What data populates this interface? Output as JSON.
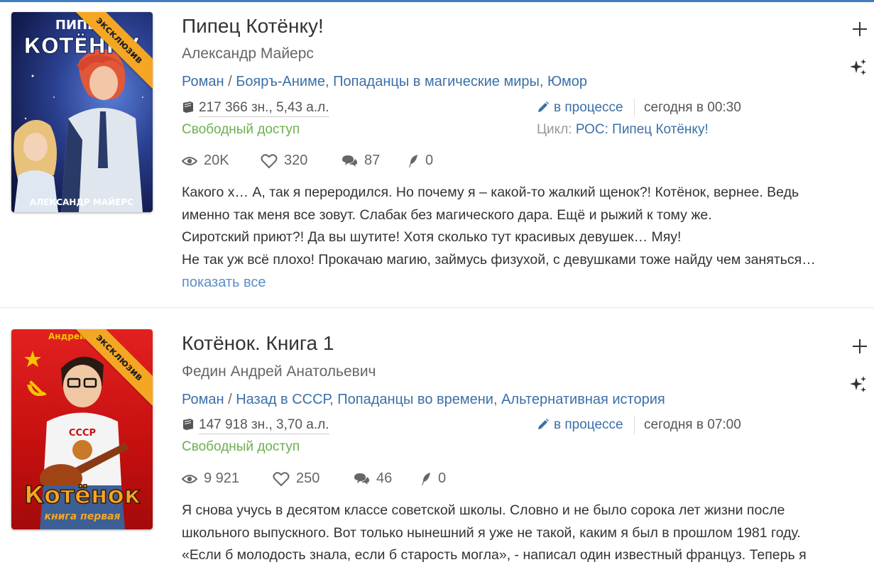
{
  "books": [
    {
      "title": "Пипец Котёнку!",
      "author": "Александр Майерс",
      "genre_main": "Роман",
      "genre_sep": " / ",
      "genres": [
        "Бояръ-Аниме",
        "Попаданцы в магические миры",
        "Юмор"
      ],
      "size": "217 366 зн., 5,43 а.л.",
      "access": "Свободный доступ",
      "status": "в процессе",
      "updated": "сегодня в 00:30",
      "cycle_label": "Цикл:",
      "cycle_name": "РОС: Пипец Котёнку!",
      "stats": {
        "views": "20K",
        "likes": "320",
        "comments": "87",
        "rewards": "0"
      },
      "badge": "эксклюзив",
      "cover_title": "ПИПЕЦ КОТЁНКУ",
      "cover_author": "АЛЕКСАНДР МАЙЕРС",
      "description": [
        "Какого х… А, так я переродился. Но почему я – какой-то жалкий щенок?! Котёнок, вернее. Ведь",
        "именно так меня все зовут. Слабак без магического дара. Ещё и рыжий к тому же.",
        "Сиротский приют?! Да вы шутите! Хотя сколько тут красивых девушек… Мяу!",
        "Не так уж всё плохо! Прокачаю магию, займусь физухой, с девушками тоже найду чем заняться…"
      ],
      "show_all": "показать все"
    },
    {
      "title": "Котёнок. Книга 1",
      "author": "Федин Андрей Анатольевич",
      "genre_main": "Роман",
      "genre_sep": " / ",
      "genres": [
        "Назад в СССР",
        "Попаданцы во времени",
        "Альтернативная история"
      ],
      "size": "147 918 зн., 3,70 а.л.",
      "access": "Свободный доступ",
      "status": "в процессе",
      "updated": "сегодня в 07:00",
      "stats": {
        "views": "9 921",
        "likes": "250",
        "comments": "46",
        "rewards": "0"
      },
      "badge": "эксклюзив",
      "cover_title": "Котёнок",
      "cover_subtitle": "книга первая",
      "cover_author": "Андрей Ф",
      "description": [
        "Я снова учусь в десятом классе советской школы. Словно и не было сорока лет жизни после",
        "школьного выпускного. Вот только нынешний я уже не такой, каким я был в прошлом 1981 году.",
        "«Если б молодость знала, если б старость могла», - написал один известный француз. Теперь я"
      ]
    }
  ],
  "colors": {
    "accent": "#3b6fa8",
    "free": "#6cb050",
    "badge": "#f5a623",
    "topline": "#3f7fc0"
  },
  "icons": [
    "book-icon",
    "pencil-icon",
    "eye-icon",
    "heart-icon",
    "comments-icon",
    "feather-icon",
    "plus-icon",
    "sparkles-icon"
  ]
}
